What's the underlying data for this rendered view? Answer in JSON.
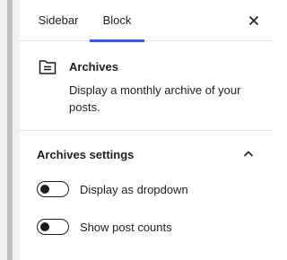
{
  "tabs": {
    "sidebar_label": "Sidebar",
    "block_label": "Block",
    "active": "Block"
  },
  "close": {
    "icon": "close-icon"
  },
  "block": {
    "icon": "archive-folder-icon",
    "title": "Archives",
    "description": "Display a monthly archive of your posts."
  },
  "settings": {
    "title": "Archives settings",
    "expanded": true,
    "toggles": [
      {
        "label": "Display as dropdown",
        "checked": false
      },
      {
        "label": "Show post counts",
        "checked": false
      }
    ]
  },
  "colors": {
    "accent": "#3858e9",
    "text": "#1e1e1e",
    "divider": "#e0e0e0"
  }
}
